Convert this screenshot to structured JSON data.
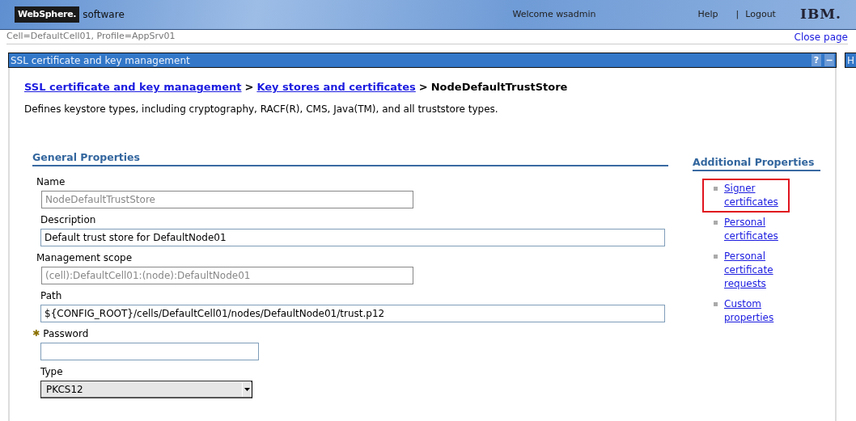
{
  "header": {
    "brand": "WebSphere.",
    "product": "software",
    "welcome": "Welcome wsadmin",
    "links": [
      "Help",
      "Logout"
    ],
    "separator": "|",
    "logo": "IBM."
  },
  "context": {
    "scope": "Cell=DefaultCell01, Profile=AppSrv01",
    "close": "Close page"
  },
  "panel": {
    "title": "SSL certificate and key management",
    "help": "?",
    "collapse": "−"
  },
  "side_panel": {
    "title": "H"
  },
  "breadcrumb": {
    "links": [
      "SSL certificate and key management",
      "Key stores and certificates"
    ],
    "separator": ">",
    "current": "NodeDefaultTrustStore"
  },
  "description": "Defines keystore types, including cryptography, RACF(R), CMS, Java(TM), and all truststore types.",
  "general": {
    "title": "General Properties",
    "required_mark": "✱",
    "fields": [
      {
        "kind": "text",
        "label": "Name",
        "value": "NodeDefaultTrustStore",
        "disabled": true,
        "required": false
      },
      {
        "kind": "text",
        "label": "Description",
        "value": "Default trust store for DefaultNode01",
        "disabled": false,
        "required": false
      },
      {
        "kind": "text",
        "label": "Management scope",
        "value": "(cell):DefaultCell01:(node):DefaultNode01",
        "disabled": true,
        "required": false
      },
      {
        "kind": "text",
        "label": "Path",
        "value": "${CONFIG_ROOT}/cells/DefaultCell01/nodes/DefaultNode01/trust.p12",
        "disabled": false,
        "required": false
      },
      {
        "kind": "password",
        "label": "Password",
        "disabled": false,
        "required": true
      },
      {
        "kind": "select",
        "label": "Type",
        "value": "PKCS12",
        "disabled": false,
        "required": false
      }
    ]
  },
  "additional": {
    "title": "Additional Properties",
    "links": [
      {
        "label": "Signer certificates",
        "highlighted": true
      },
      {
        "label": "Personal certificates",
        "highlighted": false
      },
      {
        "label": "Personal certificate requests",
        "highlighted": false
      },
      {
        "label": "Custom properties",
        "highlighted": false
      }
    ]
  }
}
